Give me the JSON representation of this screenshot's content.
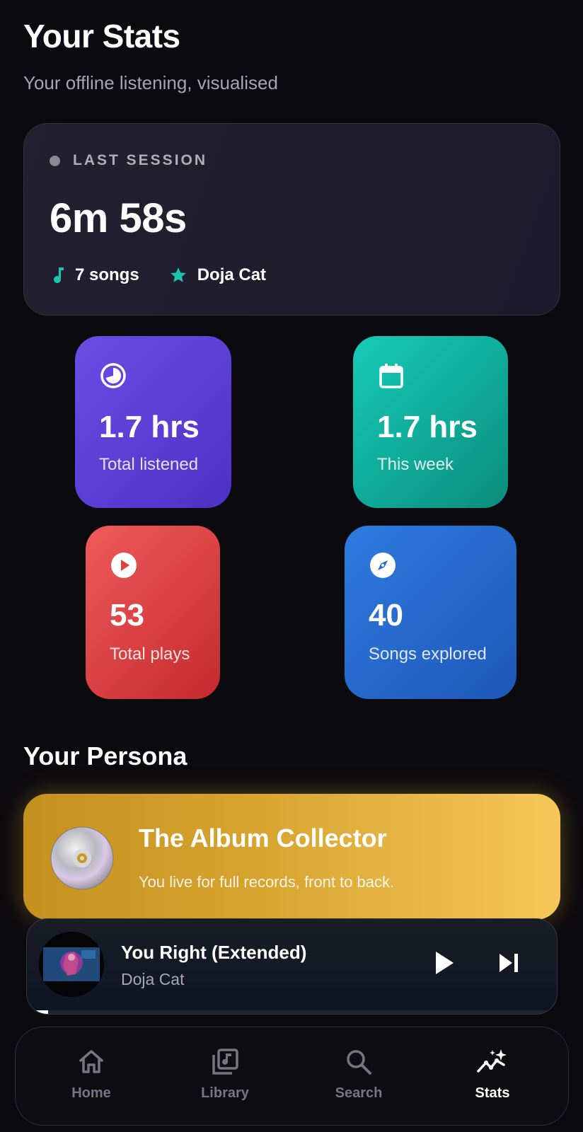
{
  "header": {
    "title": "Your Stats",
    "subtitle": "Your offline listening, visualised"
  },
  "last_session": {
    "label": "LAST SESSION",
    "duration": "6m 58s",
    "songs": "7 songs",
    "top_artist": "Doja Cat",
    "songs_icon": "music-note-icon",
    "artist_icon": "star-icon"
  },
  "stats": {
    "total_listened": {
      "value": "1.7 hrs",
      "label": "Total listened",
      "icon": "pie-clock-icon"
    },
    "this_week": {
      "value": "1.7 hrs",
      "label": "This week",
      "icon": "calendar-icon"
    },
    "total_plays": {
      "value": "53",
      "label": "Total plays",
      "icon": "play-circle-icon"
    },
    "songs_explored": {
      "value": "40",
      "label": "Songs explored",
      "icon": "compass-icon"
    }
  },
  "persona": {
    "section_title": "Your Persona",
    "title": "The Album Collector",
    "description": "You live for full records, front to back.",
    "icon": "cd-disc-icon"
  },
  "now_playing": {
    "title": "You Right (Extended)",
    "artist": "Doja Cat",
    "progress": 0.04
  },
  "nav": {
    "items": [
      {
        "label": "Home",
        "icon": "home-icon",
        "active": false
      },
      {
        "label": "Library",
        "icon": "library-icon",
        "active": false
      },
      {
        "label": "Search",
        "icon": "search-icon",
        "active": false
      },
      {
        "label": "Stats",
        "icon": "stats-icon",
        "active": true
      }
    ]
  },
  "colors": {
    "background": "#0b0a0f",
    "accent_teal": "#19c6b2",
    "total_listened_tile": "#5a3fd6",
    "this_week_tile": "#11ad9b",
    "total_plays_tile": "#dc4044",
    "songs_explored_tile": "#2669cc",
    "persona_gold": "#dcaa34"
  }
}
